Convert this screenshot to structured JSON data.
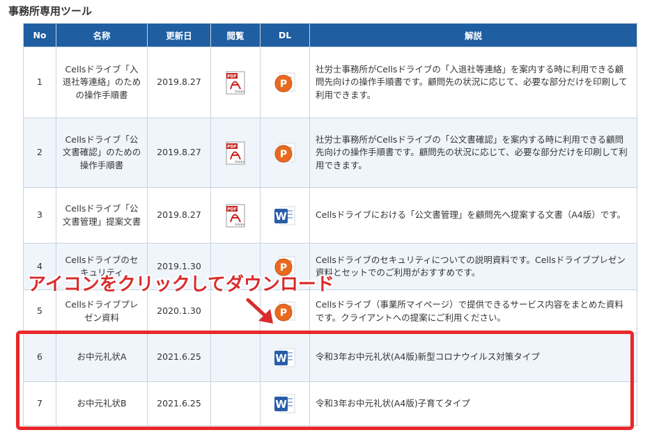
{
  "page": {
    "title": "事務所専用ツール"
  },
  "table": {
    "headers": {
      "no": "No",
      "name": "名称",
      "date": "更新日",
      "view": "閲覧",
      "dl": "DL",
      "desc": "解説"
    },
    "rows": [
      {
        "no": "1",
        "name": "Cellsドライブ「入退社等連絡」のための操作手順書",
        "date": "2019.8.27",
        "view": "pdf-icon",
        "dl": "powerpoint-icon",
        "desc": "社労士事務所がCellsドライブの「入退社等連絡」を案内する時に利用できる顧問先向けの操作手順書です。顧問先の状況に応じて、必要な部分だけを印刷して利用できます。"
      },
      {
        "no": "2",
        "name": "Cellsドライブ「公文書確認」のための操作手順書",
        "date": "2019.8.27",
        "view": "pdf-icon",
        "dl": "powerpoint-icon",
        "desc": "社労士事務所がCellsドライブの「公文書確認」を案内する時に利用できる顧問先向けの操作手順書です。顧問先の状況に応じて、必要な部分だけを印刷して利用できます。"
      },
      {
        "no": "3",
        "name": "Cellsドライブ「公文書管理」提案文書",
        "date": "2019.8.27",
        "view": "pdf-icon",
        "dl": "word-icon",
        "desc": "Cellsドライブにおける「公文書管理」を顧問先へ提案する文書（A4版）です。"
      },
      {
        "no": "4",
        "name": "Cellsドライブのセキュリティ",
        "date": "2019.1.30",
        "view": "",
        "dl": "powerpoint-icon",
        "desc": "Cellsドライブのセキュリティについての説明資料です。Cellsドライブプレゼン資料とセットでのご利用がおすすめです。"
      },
      {
        "no": "5",
        "name": "Cellsドライブプレゼン資料",
        "date": "2020.1.30",
        "view": "",
        "dl": "powerpoint-icon",
        "desc": "Cellsドライブ（事業所マイページ）で提供できるサービス内容をまとめた資料です。クライアントへの提案にご利用ください。"
      },
      {
        "no": "6",
        "name": "お中元礼状A",
        "date": "2021.6.25",
        "view": "",
        "dl": "word-icon",
        "desc": "令和3年お中元礼状(A4版)新型コロナウイルス対策タイプ"
      },
      {
        "no": "7",
        "name": "お中元礼状B",
        "date": "2021.6.25",
        "view": "",
        "dl": "word-icon",
        "desc": "令和3年お中元礼状(A4版)子育てタイプ"
      }
    ]
  },
  "annotation": {
    "text": "アイコンをクリックしてダウンロード",
    "color": "#d92c2c"
  },
  "icon_labels": {
    "pdf_badge": "PDF",
    "pdf_brand": "Adobe",
    "ppt_letter": "P",
    "word_letter": "W"
  },
  "colors": {
    "header_bg": "#1e5ea1",
    "row_alt": "#f0f5fb",
    "highlight": "#e8282b"
  }
}
